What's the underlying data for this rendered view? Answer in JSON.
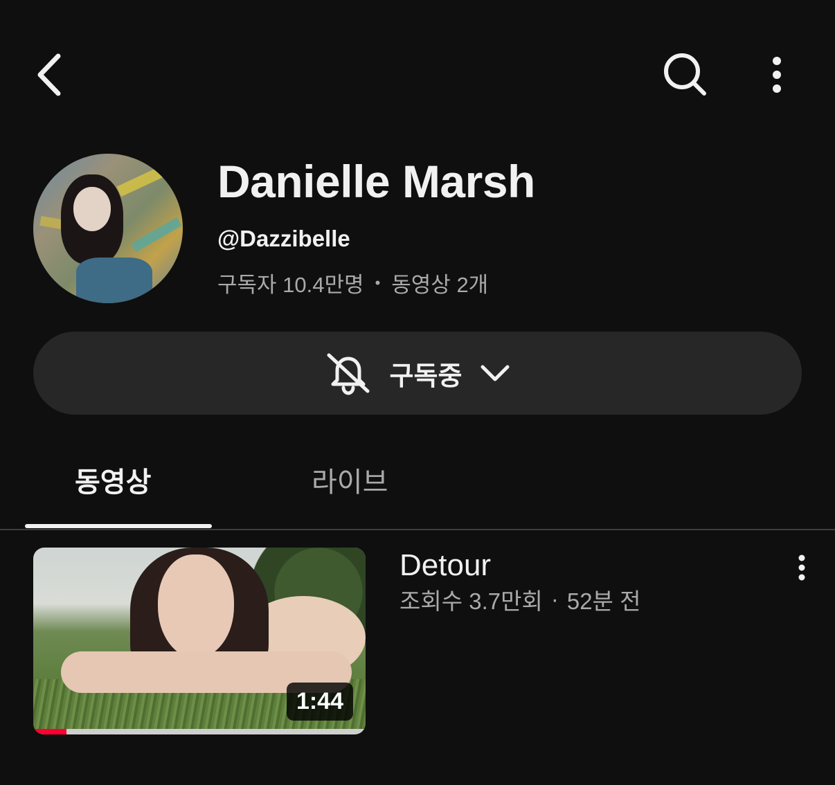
{
  "header": {
    "back_icon": "chevron-left-icon",
    "search_icon": "search-icon",
    "more_icon": "more-vertical-icon"
  },
  "channel": {
    "name": "Danielle Marsh",
    "handle": "@Dazzibelle",
    "subscribers": "구독자 10.4만명",
    "separator": "•",
    "video_count": "동영상 2개"
  },
  "subscribe_button": {
    "label": "구독중",
    "bell_icon": "bell-off-icon",
    "dropdown_icon": "chevron-down-icon"
  },
  "tabs": [
    {
      "label": "동영상",
      "selected": true
    },
    {
      "label": "라이브",
      "selected": false
    }
  ],
  "videos": [
    {
      "title": "Detour",
      "views": "조회수 3.7만회",
      "separator": "·",
      "age": "52분 전",
      "duration": "1:44",
      "watched_fraction": 0.1
    }
  ],
  "colors": {
    "background": "#0f0f0f",
    "button_bg": "#272727",
    "secondary_text": "#aaaaaa",
    "progress_red": "#ff0033"
  }
}
